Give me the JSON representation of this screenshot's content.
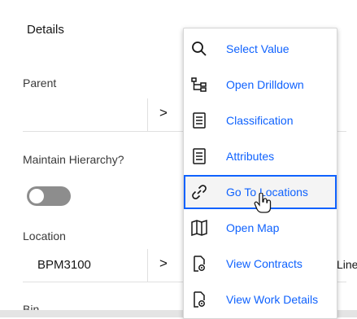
{
  "section": {
    "title": "Details"
  },
  "fields": {
    "parent": {
      "label": "Parent",
      "value": ""
    },
    "maintain_hierarchy": {
      "label": "Maintain Hierarchy?",
      "toggle_on": false
    },
    "location": {
      "label": "Location",
      "value": "BPM3100",
      "tail_text": "Line"
    },
    "bin": {
      "label": "Bin"
    }
  },
  "menu": {
    "items": [
      {
        "label": "Select Value",
        "icon": "search-icon"
      },
      {
        "label": "Open Drilldown",
        "icon": "hierarchy-icon"
      },
      {
        "label": "Classification",
        "icon": "list-icon"
      },
      {
        "label": "Attributes",
        "icon": "list-icon"
      },
      {
        "label": "Go To Locations",
        "icon": "link-icon",
        "selected": true
      },
      {
        "label": "Open Map",
        "icon": "map-icon"
      },
      {
        "label": "View Contracts",
        "icon": "document-view-icon"
      },
      {
        "label": "View Work Details",
        "icon": "document-view-icon"
      }
    ]
  },
  "colors": {
    "accent": "#0f62fe",
    "toggle_off": "#8d8d8d"
  }
}
